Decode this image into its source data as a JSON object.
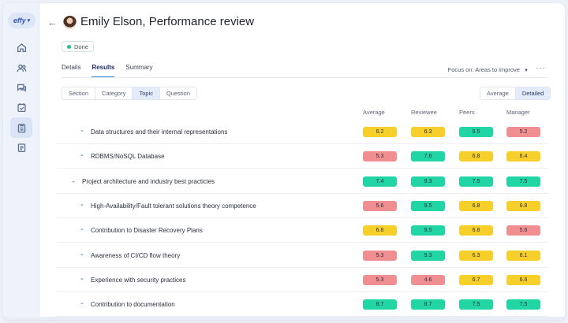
{
  "app": {
    "logo_text": "effy"
  },
  "header": {
    "title": "Emily Elson, Performance review",
    "status": "Done"
  },
  "tabs": [
    {
      "label": "Details",
      "active": false
    },
    {
      "label": "Results",
      "active": true
    },
    {
      "label": "Summary",
      "active": false
    }
  ],
  "focus": {
    "label": "Focus on: Areas to improve"
  },
  "group_by": [
    {
      "label": "Section",
      "active": false
    },
    {
      "label": "Category",
      "active": false
    },
    {
      "label": "Topic",
      "active": true
    },
    {
      "label": "Question",
      "active": false
    }
  ],
  "view_mode": [
    {
      "label": "Average",
      "active": false
    },
    {
      "label": "Detailed",
      "active": true
    }
  ],
  "columns": [
    "Average",
    "Reviewee",
    "Peers",
    "Manager"
  ],
  "colors": {
    "green": "#21d5a4",
    "yellow": "#f7cf2a",
    "red": "#f18e92",
    "accent": "#2d8ed6"
  },
  "rows": [
    {
      "label": "Data structures and their internal representations",
      "level": 2,
      "chevron": "chevron-down-icon",
      "scores": [
        {
          "value": "6.2",
          "color": "yellow"
        },
        {
          "value": "6.3",
          "color": "yellow"
        },
        {
          "value": "9.5",
          "color": "green"
        },
        {
          "value": "5.2",
          "color": "red"
        }
      ]
    },
    {
      "label": "RDBMS/NoSQL Database",
      "level": 2,
      "chevron": "chevron-down-icon",
      "scores": [
        {
          "value": "5.3",
          "color": "red"
        },
        {
          "value": "7.6",
          "color": "green"
        },
        {
          "value": "6.8",
          "color": "yellow"
        },
        {
          "value": "6.4",
          "color": "yellow"
        }
      ]
    },
    {
      "label": "Project architecture and industry best practicies",
      "level": 1,
      "chevron": "chevron-up-icon",
      "scores": [
        {
          "value": "7.4",
          "color": "green"
        },
        {
          "value": "9.3",
          "color": "green"
        },
        {
          "value": "7.5",
          "color": "green"
        },
        {
          "value": "7.5",
          "color": "green"
        }
      ]
    },
    {
      "label": "High-Availability/Fault tolerant solutions theory competence",
      "level": 2,
      "chevron": "chevron-down-icon",
      "scores": [
        {
          "value": "5.6",
          "color": "red"
        },
        {
          "value": "9.5",
          "color": "green"
        },
        {
          "value": "6.8",
          "color": "yellow"
        },
        {
          "value": "6.8",
          "color": "yellow"
        }
      ]
    },
    {
      "label": "Contribution to Disaster Recovery Plans",
      "level": 2,
      "chevron": "chevron-down-icon",
      "scores": [
        {
          "value": "6.8",
          "color": "yellow"
        },
        {
          "value": "9.5",
          "color": "green"
        },
        {
          "value": "6.8",
          "color": "yellow"
        },
        {
          "value": "5.6",
          "color": "red"
        }
      ]
    },
    {
      "label": "Awareness of CI/CD flow theory",
      "level": 2,
      "chevron": "chevron-down-icon",
      "scores": [
        {
          "value": "5.3",
          "color": "red"
        },
        {
          "value": "9.3",
          "color": "green"
        },
        {
          "value": "6.3",
          "color": "yellow"
        },
        {
          "value": "6.1",
          "color": "yellow"
        }
      ]
    },
    {
      "label": "Experience with security practices",
      "level": 2,
      "chevron": "chevron-down-icon",
      "scores": [
        {
          "value": "5.3",
          "color": "red"
        },
        {
          "value": "4.6",
          "color": "red"
        },
        {
          "value": "6.7",
          "color": "yellow"
        },
        {
          "value": "6.6",
          "color": "yellow"
        }
      ]
    },
    {
      "label": "Contribution to documentation",
      "level": 2,
      "chevron": "chevron-down-icon",
      "scores": [
        {
          "value": "8.7",
          "color": "green"
        },
        {
          "value": "8.7",
          "color": "green"
        },
        {
          "value": "7.5",
          "color": "green"
        },
        {
          "value": "7.5",
          "color": "green"
        }
      ]
    }
  ]
}
